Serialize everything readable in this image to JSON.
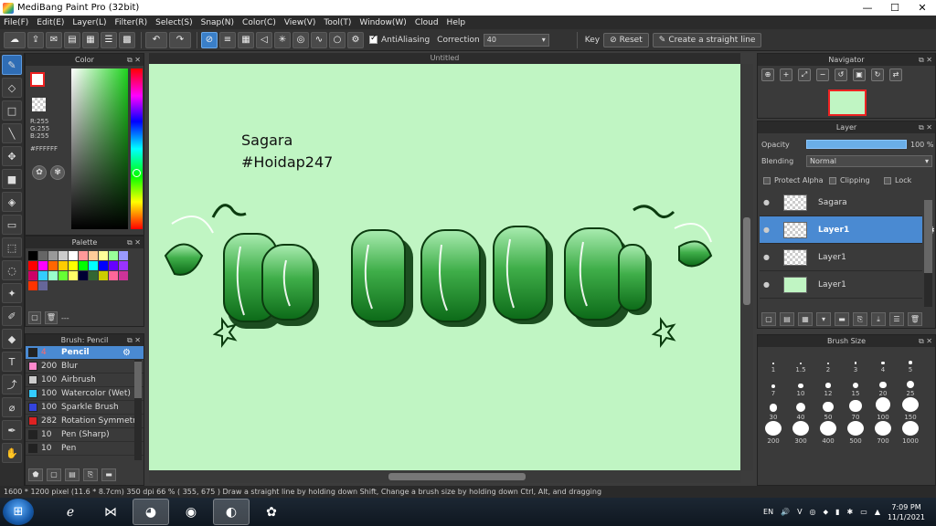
{
  "window": {
    "title": "MediBang Paint Pro (32bit)"
  },
  "menu": [
    "File(F)",
    "Edit(E)",
    "Layer(L)",
    "Filter(R)",
    "Select(S)",
    "Snap(N)",
    "Color(C)",
    "View(V)",
    "Tool(T)",
    "Window(W)",
    "Cloud",
    "Help"
  ],
  "toolbar": {
    "antialias_label": "AntiAliasing",
    "correction_label": "Correction",
    "correction_value": "40",
    "key_label": "Key",
    "reset_label": "Reset",
    "straight_line_label": "Create a straight line"
  },
  "color_panel": {
    "title": "Color",
    "r": "R:255",
    "g": "G:255",
    "b": "B:255",
    "hex": "#FFFFFF",
    "accent_fg": "#ffffff",
    "hue_base": "#1fd41f"
  },
  "palette_panel": {
    "title": "Palette",
    "colors": [
      "#000000",
      "#666666",
      "#999999",
      "#cccccc",
      "#ffffff",
      "#ff9999",
      "#ffcc99",
      "#ffff99",
      "#99ff99",
      "#9999ff",
      "#ff0000",
      "#ff00ff",
      "#ff6600",
      "#ffcc00",
      "#ffff00",
      "#00ff00",
      "#00ffff",
      "#0000ff",
      "#6600ff",
      "#9933ff",
      "#cc0066",
      "#33ccff",
      "#99ffcc",
      "#66ff33",
      "#ffff66",
      "#000033",
      "#336633",
      "#cccc00",
      "#ff6699",
      "#cc3399",
      "#ff3300",
      "#666699"
    ],
    "footer_label": "---"
  },
  "brush_panel": {
    "title": "Brush: Pencil",
    "brushes": [
      {
        "size": "4",
        "name": "Pencil",
        "color": "#222222",
        "selected": true
      },
      {
        "size": "200",
        "name": "Blur",
        "color": "#ff88cc",
        "selected": false
      },
      {
        "size": "100",
        "name": "Airbrush",
        "color": "#cccccc",
        "selected": false
      },
      {
        "size": "100",
        "name": "Watercolor (Wet)",
        "color": "#33ccff",
        "selected": false
      },
      {
        "size": "100",
        "name": "Sparkle Brush",
        "color": "#3344dd",
        "selected": false
      },
      {
        "size": "282",
        "name": "Rotation Symmetr",
        "color": "#dd2222",
        "selected": false
      },
      {
        "size": "10",
        "name": "Pen (Sharp)",
        "color": "#222222",
        "selected": false
      },
      {
        "size": "10",
        "name": "Pen",
        "color": "#222222",
        "selected": false
      }
    ]
  },
  "canvas": {
    "tab_title": "Untitled",
    "text_line1": "Sagara",
    "text_line2": "#Hoidap247",
    "background": "#c0f5c3"
  },
  "navigator": {
    "title": "Navigator"
  },
  "layer_panel": {
    "title": "Layer",
    "opacity_label": "Opacity",
    "opacity_value": "100 %",
    "blending_label": "Blending",
    "blending_value": "Normal",
    "protect_alpha": "Protect Alpha",
    "clipping": "Clipping",
    "lock": "Lock",
    "layers": [
      {
        "name": "Sagara",
        "selected": false
      },
      {
        "name": "Layer1",
        "selected": true
      },
      {
        "name": "Layer1",
        "selected": false
      },
      {
        "name": "Layer1",
        "selected": false
      }
    ]
  },
  "brush_size_panel": {
    "title": "Brush Size",
    "sizes": [
      "1",
      "1.5",
      "2",
      "3",
      "4",
      "5",
      "7",
      "10",
      "12",
      "15",
      "20",
      "25",
      "30",
      "40",
      "50",
      "70",
      "100",
      "150",
      "200",
      "300",
      "400",
      "500",
      "700",
      "1000"
    ]
  },
  "statusbar": {
    "text": "1600 * 1200 pixel  (11.6 * 8.7cm)  350 dpi  66 %  ( 355, 675 )  Draw a straight line by holding down Shift, Change a brush size by holding down Ctrl, Alt, and dragging"
  },
  "taskbar": {
    "lang": "EN",
    "time": "7:09 PM",
    "date": "11/1/2021"
  }
}
